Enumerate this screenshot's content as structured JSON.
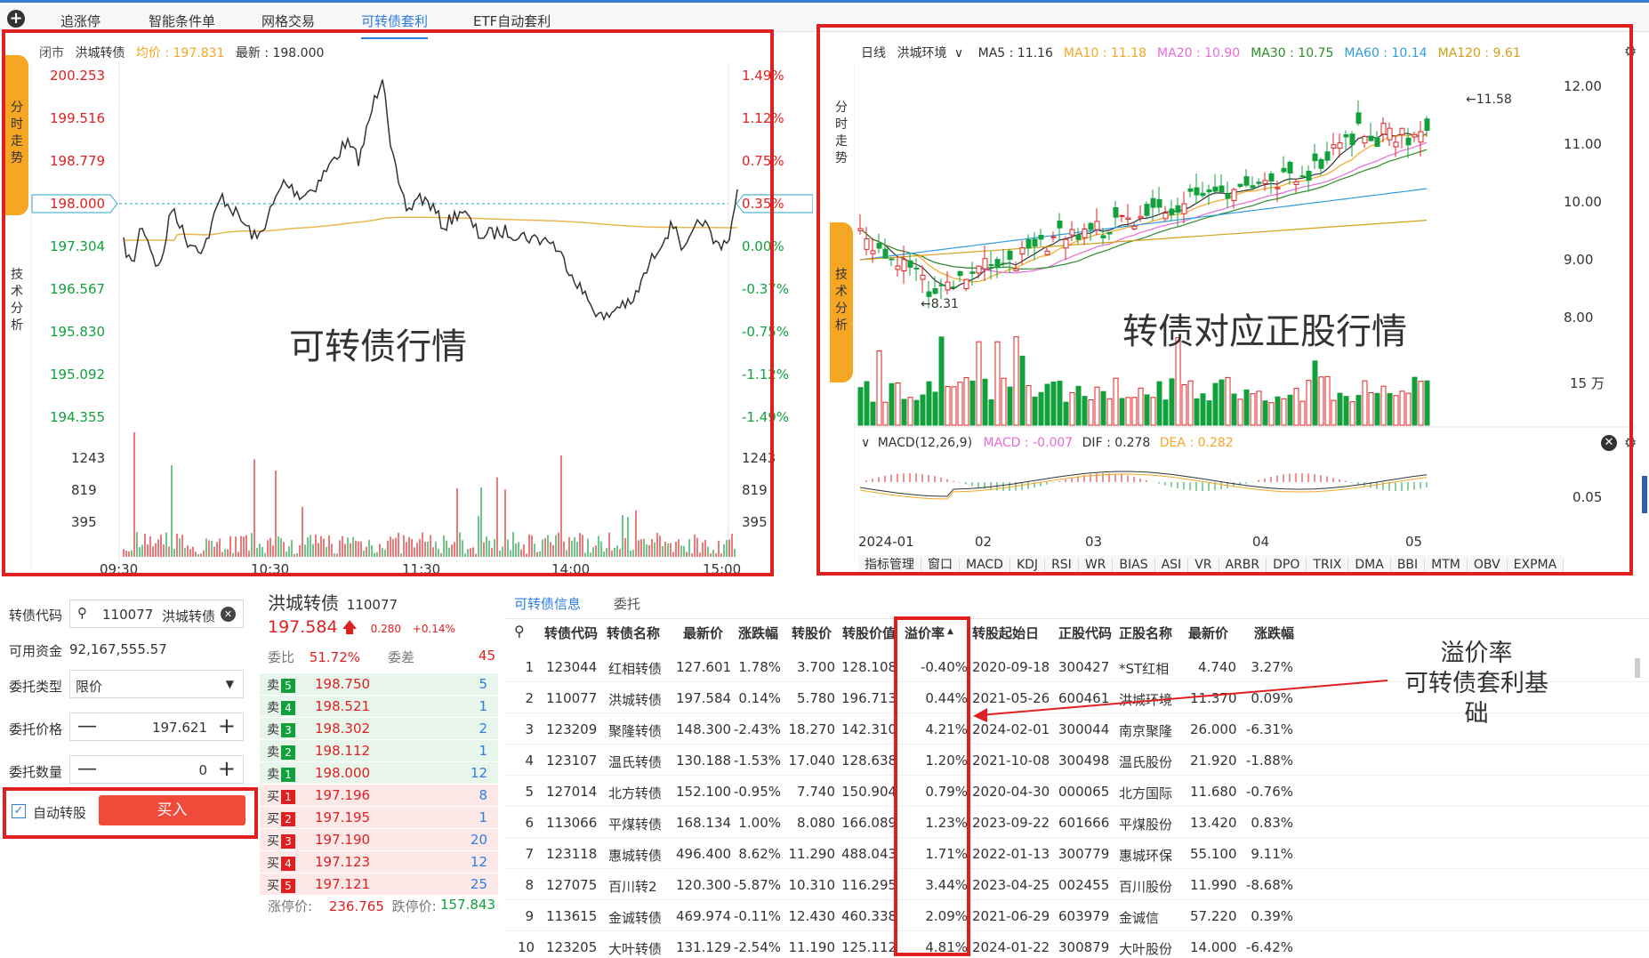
{
  "tabs": [
    {
      "label": "追涨停",
      "active": false
    },
    {
      "label": "智能条件单",
      "active": false
    },
    {
      "label": "网格交易",
      "active": false
    },
    {
      "label": "可转债套利",
      "active": true
    },
    {
      "label": "ETF自动套利",
      "active": false
    }
  ],
  "left_chart": {
    "status": "闭市",
    "name": "洪城转债",
    "avg_label": "均价 : 197.831",
    "last_label": "最新 : 198.000",
    "side_top": [
      "分",
      "时",
      "走",
      "势"
    ],
    "side_bottom": [
      "技",
      "术",
      "分",
      "析"
    ],
    "overlay_title": "可转债行情",
    "price_ticks": [
      "200.253",
      "199.516",
      "198.779",
      "198.000",
      "197.304",
      "196.567",
      "195.830",
      "195.092",
      "194.355"
    ],
    "pct_ticks": [
      "1.49%",
      "1.12%",
      "0.75%",
      "0.35%",
      "0.00%",
      "-0.37%",
      "-0.75%",
      "-1.12%",
      "-1.49%"
    ],
    "vol_ticks": [
      "1243",
      "819",
      "395"
    ],
    "time_ticks": [
      "09:30",
      "10:30",
      "11:30",
      "14:00",
      "15:00"
    ]
  },
  "right_chart": {
    "period": "日线",
    "name": "洪城环境",
    "ma": [
      {
        "label": "MA5 : 11.16",
        "color": "#333333"
      },
      {
        "label": "MA10 : 11.18",
        "color": "#f5a623"
      },
      {
        "label": "MA20 : 10.90",
        "color": "#e66bd6"
      },
      {
        "label": "MA30 : 10.75",
        "color": "#2a8c2a"
      },
      {
        "label": "MA60 : 10.14",
        "color": "#2f9de1"
      },
      {
        "label": "MA120 : 9.61",
        "color": "#d4a017"
      }
    ],
    "side_top": [
      "分",
      "时",
      "走",
      "势"
    ],
    "side_bottom": [
      "技",
      "术",
      "分",
      "析"
    ],
    "overlay_title": "转债对应正股行情",
    "price_ticks": [
      "12.00",
      "11.00",
      "10.00",
      "9.00",
      "8.00"
    ],
    "vol_tick": "15 万",
    "high_mark": "←11.58",
    "low_mark": "←8.31",
    "macd_label": "MACD(12,26,9)",
    "macd_val": "MACD : -0.007",
    "dif_val": "DIF : 0.278",
    "dea_val": "DEA : 0.282",
    "macd_tick": "0.05",
    "date_ticks": [
      "2024-01",
      "02",
      "03",
      "04",
      "05"
    ],
    "indicators": [
      "指标管理",
      "窗口",
      "MACD",
      "KDJ",
      "RSI",
      "WR",
      "BIAS",
      "ASI",
      "VR",
      "ARBR",
      "DPO",
      "TRIX",
      "DMA",
      "BBI",
      "MTM",
      "OBV",
      "EXPMA"
    ]
  },
  "order_form": {
    "code_label": "转债代码",
    "code_value": "110077",
    "code_name": "洪城转债",
    "funds_label": "可用资金",
    "funds_value": "92,167,555.57",
    "type_label": "委托类型",
    "type_value": "限价",
    "price_label": "委托价格",
    "price_value": "197.621",
    "qty_label": "委托数量",
    "qty_value": "0",
    "auto_label": "自动转股",
    "buy_label": "买入"
  },
  "quote": {
    "name": "洪城转债",
    "code": "110077",
    "price": "197.584",
    "change": "0.280",
    "change_pct": "+0.14%",
    "ratio_label": "委比",
    "ratio_value": "51.72%",
    "diff_label": "委差",
    "diff_value": "45",
    "asks": [
      {
        "tag": "卖",
        "n": "5",
        "price": "198.750",
        "vol": "5"
      },
      {
        "tag": "卖",
        "n": "4",
        "price": "198.521",
        "vol": "1"
      },
      {
        "tag": "卖",
        "n": "3",
        "price": "198.302",
        "vol": "2"
      },
      {
        "tag": "卖",
        "n": "2",
        "price": "198.112",
        "vol": "1"
      },
      {
        "tag": "卖",
        "n": "1",
        "price": "198.000",
        "vol": "12"
      }
    ],
    "bids": [
      {
        "tag": "买",
        "n": "1",
        "price": "197.196",
        "vol": "8"
      },
      {
        "tag": "买",
        "n": "2",
        "price": "197.195",
        "vol": "1"
      },
      {
        "tag": "买",
        "n": "3",
        "price": "197.190",
        "vol": "20"
      },
      {
        "tag": "买",
        "n": "4",
        "price": "197.123",
        "vol": "12"
      },
      {
        "tag": "买",
        "n": "5",
        "price": "197.121",
        "vol": "25"
      }
    ],
    "limit_up_label": "涨停价:",
    "limit_up": "236.765",
    "limit_down_label": "跌停价:",
    "limit_down": "157.843"
  },
  "table": {
    "tabs": [
      "可转债信息",
      "委托"
    ],
    "headers": [
      "转债代码",
      "转债名称",
      "最新价",
      "涨跌幅",
      "转股价",
      "转股价值",
      "溢价率",
      "转股起始日",
      "正股代码",
      "正股名称",
      "最新价",
      "涨跌幅"
    ],
    "rows": [
      [
        "1",
        "123044",
        "红相转债",
        "127.601",
        "1.78%",
        "3.700",
        "128.108",
        "-0.40%",
        "2020-09-18",
        "300427",
        "*ST红相",
        "4.740",
        "3.27%"
      ],
      [
        "2",
        "110077",
        "洪城转债",
        "197.584",
        "0.14%",
        "5.780",
        "196.713",
        "0.44%",
        "2021-05-26",
        "600461",
        "洪城环境",
        "11.370",
        "0.09%"
      ],
      [
        "3",
        "123209",
        "聚隆转债",
        "148.300",
        "-2.43%",
        "18.270",
        "142.310",
        "4.21%",
        "2024-02-01",
        "300044",
        "南京聚隆",
        "26.000",
        "-6.31%"
      ],
      [
        "4",
        "123107",
        "温氏转债",
        "130.188",
        "-1.53%",
        "17.040",
        "128.638",
        "1.20%",
        "2021-10-08",
        "300498",
        "温氏股份",
        "21.920",
        "-1.88%"
      ],
      [
        "5",
        "127014",
        "北方转债",
        "152.100",
        "-0.95%",
        "7.740",
        "150.904",
        "0.79%",
        "2020-04-30",
        "000065",
        "北方国际",
        "11.680",
        "-0.76%"
      ],
      [
        "6",
        "113066",
        "平煤转债",
        "168.134",
        "1.00%",
        "8.080",
        "166.089",
        "1.23%",
        "2023-09-22",
        "601666",
        "平煤股份",
        "13.420",
        "0.83%"
      ],
      [
        "7",
        "123118",
        "惠城转债",
        "496.400",
        "8.62%",
        "11.290",
        "488.043",
        "1.71%",
        "2022-01-13",
        "300779",
        "惠城环保",
        "55.100",
        "9.11%"
      ],
      [
        "8",
        "127075",
        "百川转2",
        "120.300",
        "-5.87%",
        "10.310",
        "116.295",
        "3.44%",
        "2023-04-25",
        "002455",
        "百川股份",
        "11.990",
        "-8.68%"
      ],
      [
        "9",
        "113615",
        "金诚转债",
        "469.974",
        "-0.11%",
        "12.430",
        "460.338",
        "2.09%",
        "2021-06-29",
        "603979",
        "金诚信",
        "57.220",
        "0.39%"
      ],
      [
        "10",
        "123205",
        "大叶转债",
        "131.129",
        "-2.54%",
        "11.190",
        "125.112",
        "4.81%",
        "2024-01-22",
        "300879",
        "大叶股份",
        "14.000",
        "-6.42%"
      ]
    ]
  },
  "annotation": [
    "溢价率",
    "可转债套利基础"
  ]
}
